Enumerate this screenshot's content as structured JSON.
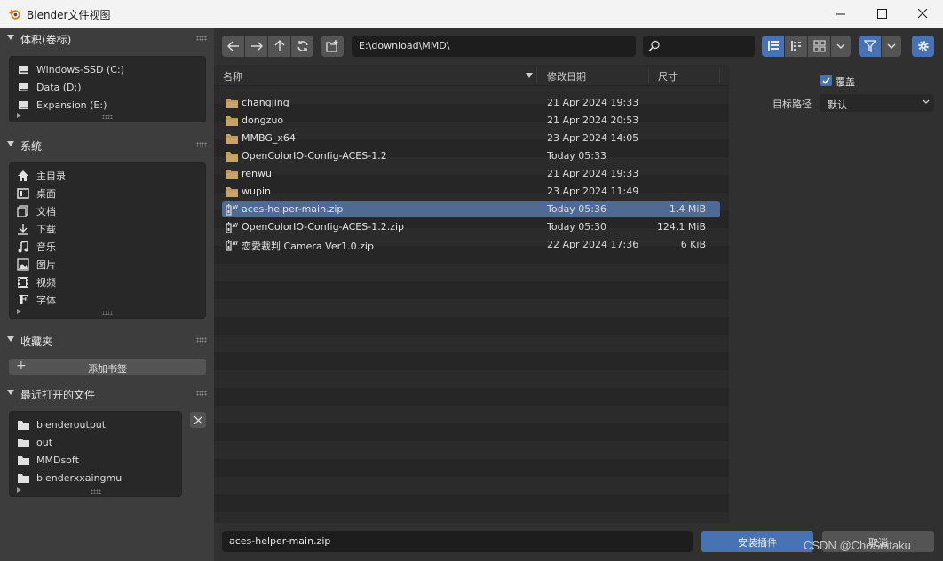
{
  "window": {
    "title": "Blender文件视图"
  },
  "sidebar": {
    "volumes": {
      "header": "体积(卷标)",
      "items": [
        {
          "label": "Windows-SSD (C:)",
          "icon": "drive-icon"
        },
        {
          "label": "Data (D:)",
          "icon": "drive-icon"
        },
        {
          "label": "Expansion (E:)",
          "icon": "drive-icon"
        }
      ]
    },
    "system": {
      "header": "系统",
      "items": [
        {
          "label": "主目录",
          "icon": "home-icon"
        },
        {
          "label": "桌面",
          "icon": "desktop-icon"
        },
        {
          "label": "文档",
          "icon": "documents-icon"
        },
        {
          "label": "下载",
          "icon": "download-icon"
        },
        {
          "label": "音乐",
          "icon": "music-icon"
        },
        {
          "label": "图片",
          "icon": "image-icon"
        },
        {
          "label": "视频",
          "icon": "video-icon"
        },
        {
          "label": "字体",
          "icon": "font-icon"
        }
      ]
    },
    "bookmarks": {
      "header": "收藏夹",
      "add_label": "添加书签"
    },
    "recent": {
      "header": "最近打开的文件",
      "items": [
        {
          "label": "blenderoutput",
          "icon": "folder-icon"
        },
        {
          "label": "out",
          "icon": "folder-icon"
        },
        {
          "label": "MMDsoft",
          "icon": "folder-icon"
        },
        {
          "label": "blenderxxaingmu",
          "icon": "folder-icon"
        }
      ]
    }
  },
  "toolbar": {
    "path": "E:\\download\\MMD\\",
    "search_placeholder": ""
  },
  "filelist": {
    "columns": {
      "name": "名称",
      "date": "修改日期",
      "size": "尺寸"
    },
    "rows": [
      {
        "name": "changjing",
        "date": "21 Apr 2024 19:33",
        "size": "",
        "type": "folder",
        "selected": false
      },
      {
        "name": "dongzuo",
        "date": "21 Apr 2024 20:53",
        "size": "",
        "type": "folder",
        "selected": false
      },
      {
        "name": "MMBG_x64",
        "date": "23 Apr 2024 14:05",
        "size": "",
        "type": "folder",
        "selected": false
      },
      {
        "name": "OpenColorIO-Config-ACES-1.2",
        "date": "Today 05:33",
        "size": "",
        "type": "folder",
        "selected": false
      },
      {
        "name": "renwu",
        "date": "21 Apr 2024 19:33",
        "size": "",
        "type": "folder",
        "selected": false
      },
      {
        "name": "wupin",
        "date": "23 Apr 2024 11:49",
        "size": "",
        "type": "folder",
        "selected": false
      },
      {
        "name": "aces-helper-main.zip",
        "date": "Today 05:36",
        "size": "1.4 MiB",
        "type": "zip",
        "selected": true
      },
      {
        "name": "OpenColorIO-Config-ACES-1.2.zip",
        "date": "Today 05:30",
        "size": "124.1 MiB",
        "type": "zip",
        "selected": false
      },
      {
        "name": "恋愛裁判 Camera Ver1.0.zip",
        "date": "22 Apr 2024 17:36",
        "size": "6 KiB",
        "type": "zip",
        "selected": false
      }
    ]
  },
  "options": {
    "overwrite_label": "覆盖",
    "overwrite_checked": true,
    "target_label": "目标路径",
    "target_value": "默认"
  },
  "bottom": {
    "filename": "aces-helper-main.zip",
    "install_label": "安装插件",
    "cancel_label": "取消"
  },
  "watermark": "CSDN @ChoSeitaku",
  "colors": {
    "accent": "#4772b3",
    "selected_row": "#4f6a94",
    "folder": "#c8a46a"
  }
}
